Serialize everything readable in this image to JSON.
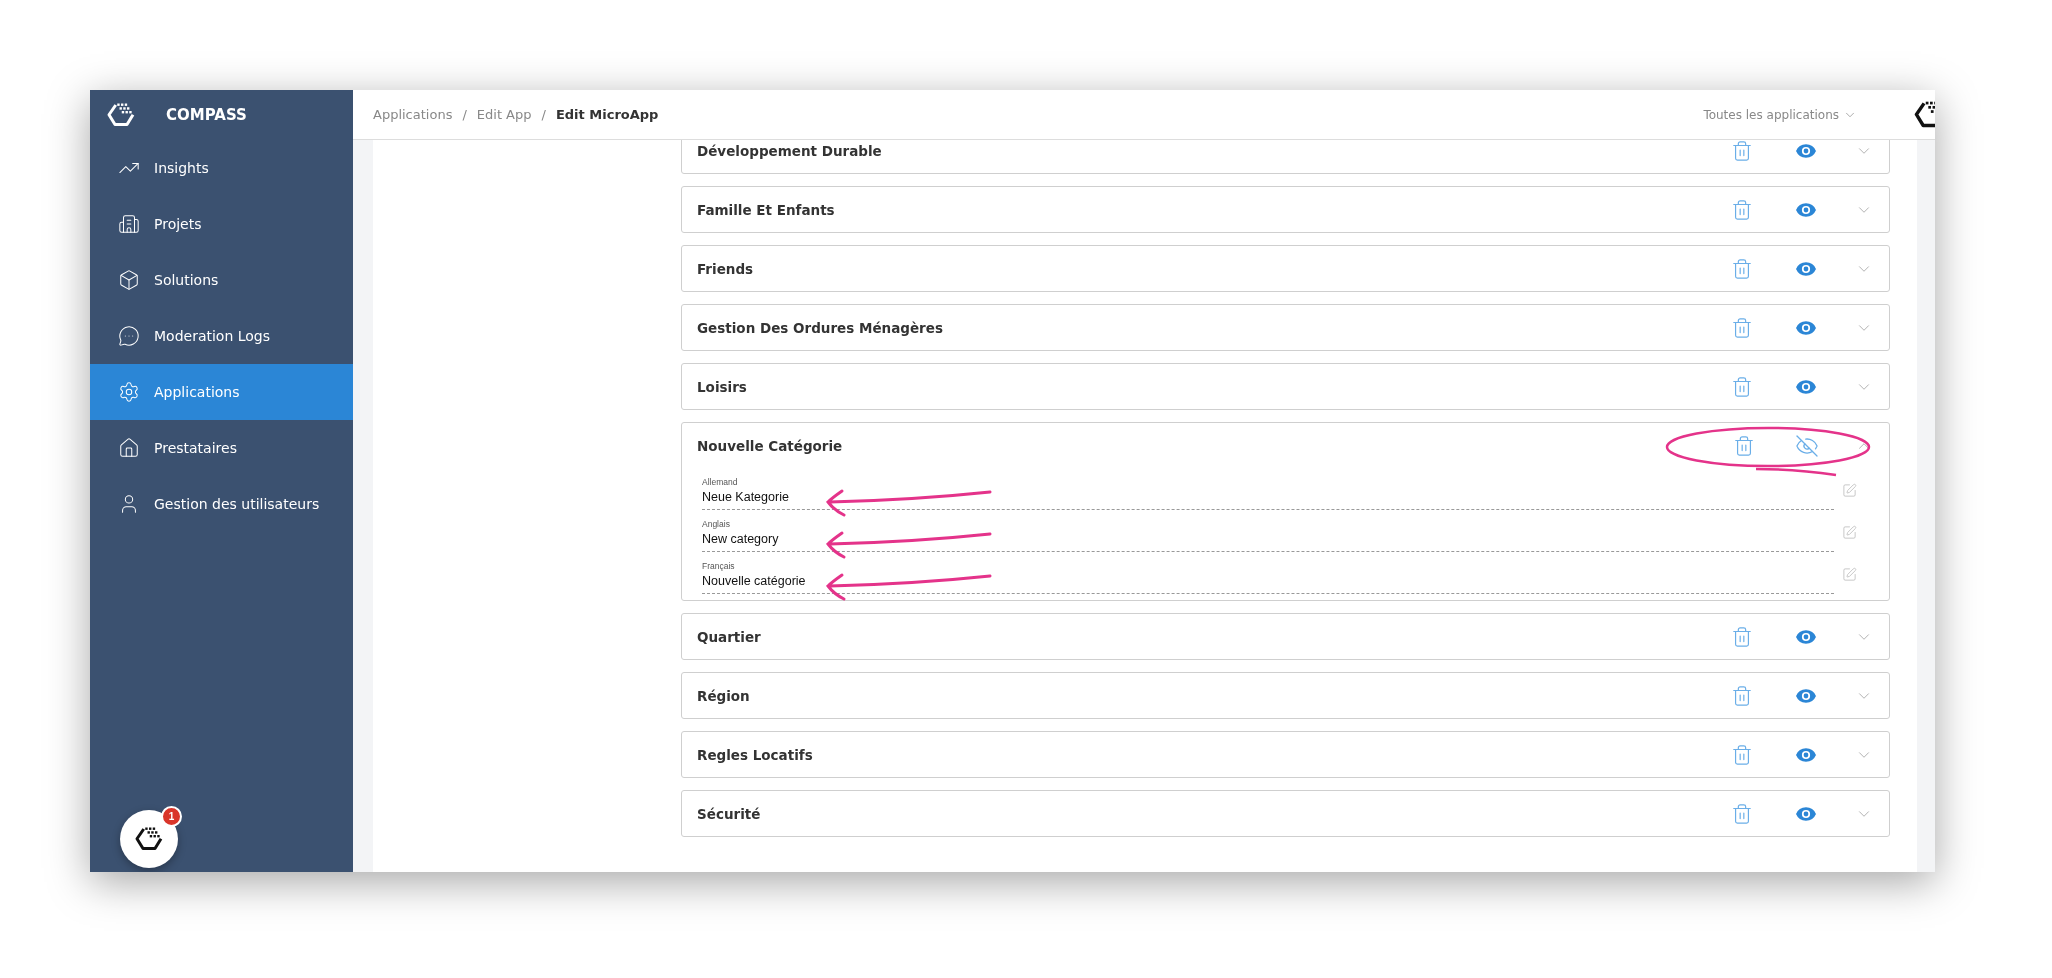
{
  "brand": "COMPASS",
  "sidebar": {
    "items": [
      {
        "label": "Insights",
        "selected": false
      },
      {
        "label": "Projets",
        "selected": false
      },
      {
        "label": "Solutions",
        "selected": false
      },
      {
        "label": "Moderation Logs",
        "selected": false
      },
      {
        "label": "Applications",
        "selected": true
      },
      {
        "label": "Prestataires",
        "selected": false
      },
      {
        "label": "Gestion des utilisateurs",
        "selected": false
      }
    ],
    "chat_badge": "1"
  },
  "breadcrumb": [
    {
      "label": "Applications",
      "current": false
    },
    {
      "label": "Edit App",
      "current": false
    },
    {
      "label": "Edit MicroApp",
      "current": true
    }
  ],
  "separator": "/",
  "app_filter": "Toutes les applications",
  "categories": [
    {
      "name": "Développement Durable",
      "visible": true,
      "expanded": false
    },
    {
      "name": "Famille Et Enfants",
      "visible": true,
      "expanded": false
    },
    {
      "name": "Friends",
      "visible": true,
      "expanded": false
    },
    {
      "name": "Gestion Des Ordures Ménagères",
      "visible": true,
      "expanded": false
    },
    {
      "name": "Loisirs",
      "visible": true,
      "expanded": false
    },
    {
      "name": "Nouvelle Catégorie",
      "visible": false,
      "expanded": true,
      "annotated": true,
      "fields": [
        {
          "label": "Allemand",
          "value": "Neue Kategorie",
          "annotated": true
        },
        {
          "label": "Anglais",
          "value": "New category",
          "annotated": true
        },
        {
          "label": "Français",
          "value": "Nouvelle catégorie",
          "annotated": true
        }
      ]
    },
    {
      "name": "Quartier",
      "visible": true,
      "expanded": false
    },
    {
      "name": "Région",
      "visible": true,
      "expanded": false
    },
    {
      "name": "Regles Locatifs",
      "visible": true,
      "expanded": false
    },
    {
      "name": "Sécurité",
      "visible": true,
      "expanded": false
    }
  ]
}
